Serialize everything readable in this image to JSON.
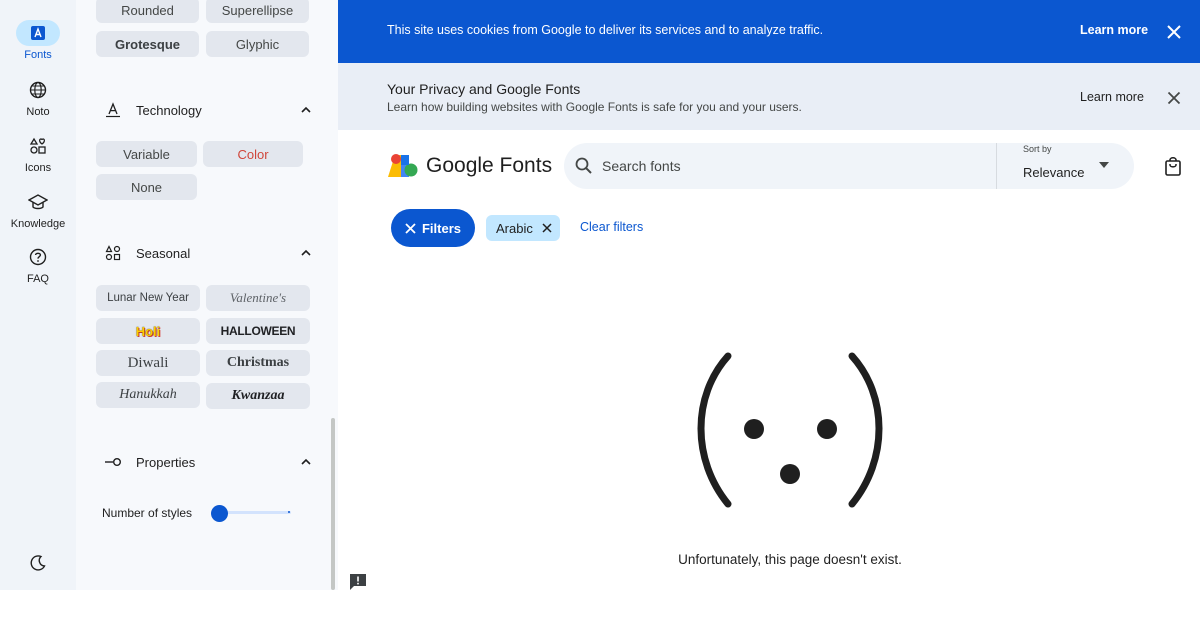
{
  "rail": {
    "items": [
      {
        "label": "Fonts",
        "icon": "fonts-icon",
        "active": true
      },
      {
        "label": "Noto",
        "icon": "globe-icon"
      },
      {
        "label": "Icons",
        "icon": "icons-icon"
      },
      {
        "label": "Knowledge",
        "icon": "graduation-cap-icon"
      },
      {
        "label": "FAQ",
        "icon": "help-icon"
      }
    ],
    "theme_icon": "moon-icon"
  },
  "panel": {
    "top_chips": [
      "Rounded",
      "Superellipse",
      "Grotesque",
      "Glyphic"
    ],
    "technology": {
      "title": "Technology",
      "chips": [
        "Variable",
        "Color",
        "None"
      ]
    },
    "seasonal": {
      "title": "Seasonal",
      "chips": [
        "Lunar New Year",
        "Valentine's",
        "Holi",
        "HALLOWEEN",
        "Diwali",
        "Christmas",
        "Hanukkah",
        "Kwanzaa"
      ]
    },
    "properties": {
      "title": "Properties",
      "slider_label": "Number of styles",
      "slider_value": 0
    }
  },
  "cookie_banner": {
    "message": "This site uses cookies from Google to deliver its services and to analyze traffic.",
    "learn_more": "Learn more"
  },
  "privacy_banner": {
    "title": "Your Privacy and Google Fonts",
    "subtitle": "Learn how building websites with Google Fonts is safe for you and your users.",
    "learn_more": "Learn more"
  },
  "header": {
    "brand": "Google Fonts",
    "search_placeholder": "Search fonts",
    "sort_label": "Sort by",
    "sort_value": "Relevance"
  },
  "filter_row": {
    "filters_label": "Filters",
    "active_filter": "Arabic",
    "clear_label": "Clear filters"
  },
  "error": {
    "message": "Unfortunately, this page doesn't exist."
  },
  "colors": {
    "accent": "#0b57d0",
    "rail_bg": "#f0f4f9",
    "chip_bg": "#e3e7ee",
    "active_chip": "#c2e7ff"
  }
}
